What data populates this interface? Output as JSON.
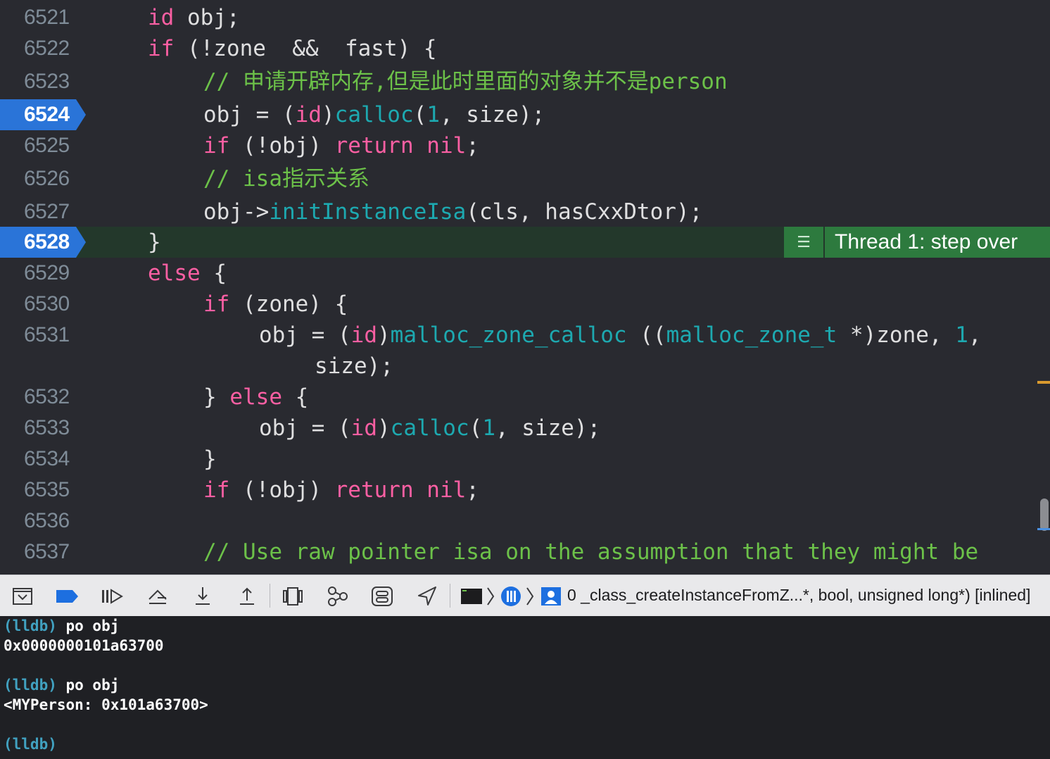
{
  "editor": {
    "lines": [
      {
        "num": "6521"
      },
      {
        "num": "6522"
      },
      {
        "num": "6523"
      },
      {
        "num": "6524",
        "breakpoint": true
      },
      {
        "num": "6525"
      },
      {
        "num": "6526"
      },
      {
        "num": "6527"
      },
      {
        "num": "6528",
        "breakpoint": true,
        "current": true
      },
      {
        "num": "6529"
      },
      {
        "num": "6530"
      },
      {
        "num": "6531"
      },
      {
        "num": "6532"
      },
      {
        "num": "6533"
      },
      {
        "num": "6534"
      },
      {
        "num": "6535"
      },
      {
        "num": "6536"
      },
      {
        "num": "6537"
      }
    ],
    "code": {
      "l6521": [
        "id",
        " obj;"
      ],
      "l6522": [
        "if",
        " (!zone  &&  fast) {"
      ],
      "l6523": "// 申请开辟内存,但是此时里面的对象并不是person",
      "l6524": [
        "obj = (",
        "id",
        ")",
        "calloc",
        "(",
        "1",
        ", size);"
      ],
      "l6525": [
        "if",
        " (!obj) ",
        "return",
        " ",
        "nil",
        ";"
      ],
      "l6526": "// isa指示关系",
      "l6527": [
        "obj->",
        "initInstanceIsa",
        "(cls, hasCxxDtor);"
      ],
      "l6528": "}",
      "l6529": [
        "else",
        " {"
      ],
      "l6530": [
        "if",
        " (zone) {"
      ],
      "l6531": [
        "obj = (",
        "id",
        ")",
        "malloc_zone_calloc",
        " ((",
        "malloc_zone_t",
        " *)zone, ",
        "1",
        ","
      ],
      "l6531b": "size);",
      "l6532": [
        "} ",
        "else",
        " {"
      ],
      "l6533": [
        "obj = (",
        "id",
        ")",
        "calloc",
        "(",
        "1",
        ", size);"
      ],
      "l6534": "}",
      "l6535": [
        "if",
        " (!obj) ",
        "return",
        " ",
        "nil",
        ";"
      ],
      "l6537": "// Use raw pointer isa on the assumption that they might be"
    },
    "thread_badge": "Thread 1: step over"
  },
  "toolbar": {
    "icons": [
      "hide-debug-area-icon",
      "breakpoints-toggle-icon",
      "continue-icon",
      "step-over-icon",
      "step-into-icon",
      "step-out-icon",
      "view-hierarchy-icon",
      "memory-graph-icon",
      "environment-overrides-icon",
      "simulate-location-icon",
      "terminal-icon",
      "thread-icon",
      "user-frame-icon"
    ],
    "frame_label": "0 _class_createInstanceFromZ...*, bool, unsigned long*) [inlined]"
  },
  "console": {
    "lines": [
      {
        "prompt": "(lldb)",
        "text": " po obj"
      },
      {
        "output": "0x0000000101a63700"
      },
      {
        "output": ""
      },
      {
        "prompt": "(lldb)",
        "text": " po obj"
      },
      {
        "output": "<MYPerson: 0x101a63700>"
      },
      {
        "output": ""
      },
      {
        "prompt": "(lldb)",
        "text": ""
      }
    ]
  },
  "colors": {
    "editor_bg": "#292a30",
    "keyword": "#fc5fa3",
    "function": "#67b7a4",
    "comment": "#6cc149",
    "number": "#d0bf69",
    "breakpoint": "#2a74d8",
    "current_line": "#23382b",
    "thread_badge": "#2d7a3e"
  }
}
